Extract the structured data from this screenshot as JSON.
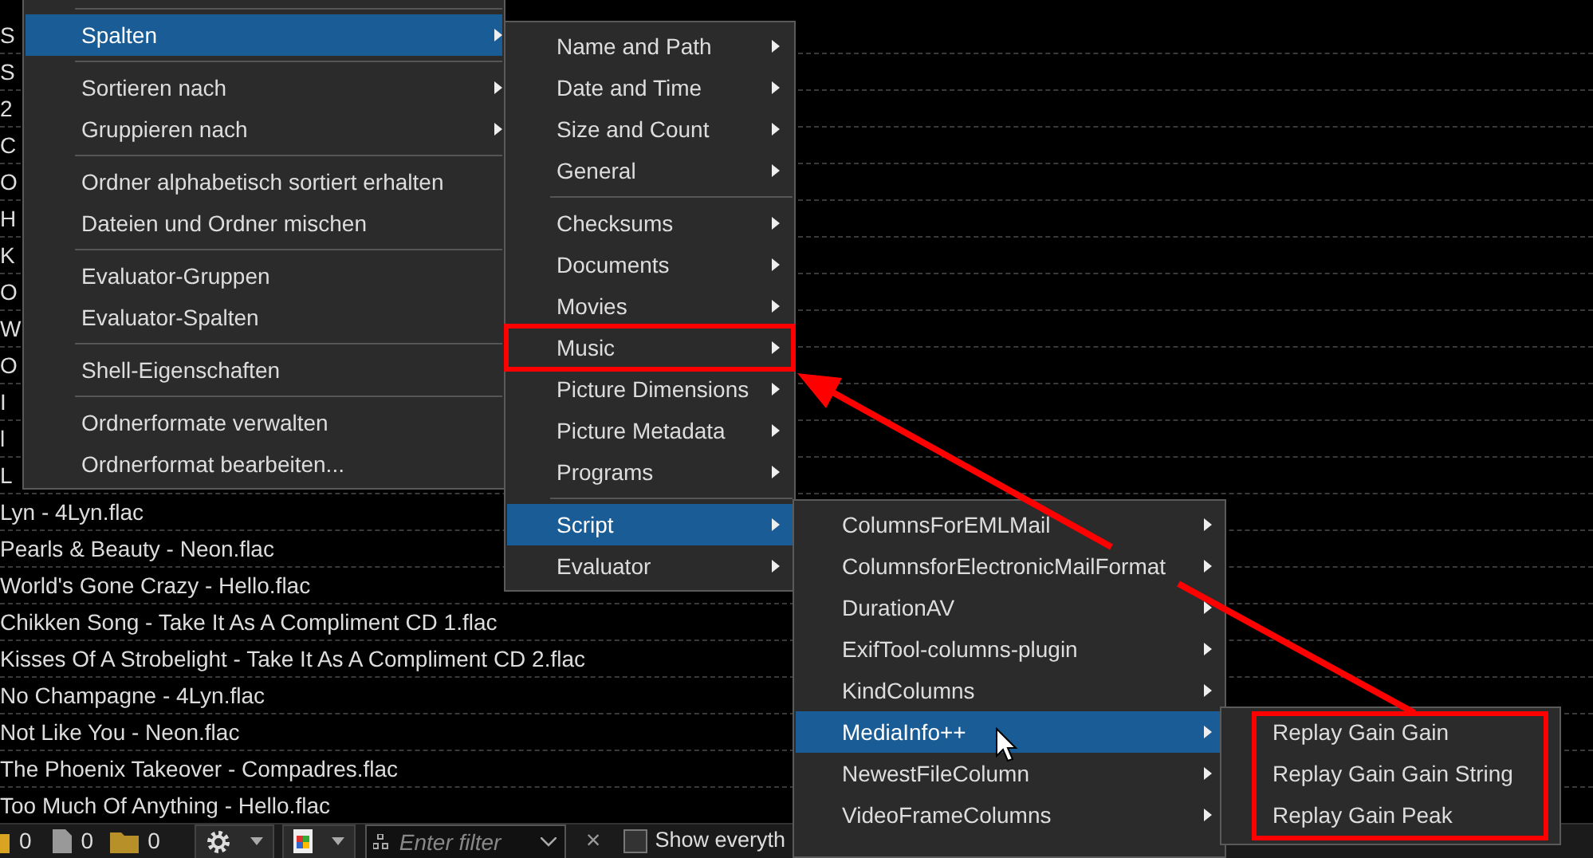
{
  "file_list": {
    "rows": [
      "S",
      "S",
      "2",
      "C",
      "O",
      "H",
      "K",
      "O",
      "W",
      "O",
      "I",
      "l",
      "L",
      "Lyn - 4Lyn.flac",
      "Pearls & Beauty - Neon.flac",
      "World's Gone Crazy - Hello.flac",
      "Chikken Song - Take It As A Compliment CD 1.flac",
      "Kisses Of A Strobelight - Take It As A Compliment CD 2.flac",
      "No Champagne - 4Lyn.flac",
      "Not Like You - Neon.flac",
      "The Phoenix Takeover - Compadres.flac",
      "Too Much Of Anything - Hello.flac"
    ]
  },
  "menus": [
    {
      "items": [
        {
          "kind": "separator"
        },
        {
          "kind": "item",
          "label": "Spalten",
          "selected": true,
          "submenu": true,
          "annotated": false
        },
        {
          "kind": "separator"
        },
        {
          "kind": "item",
          "label": "Sortieren nach",
          "selected": false,
          "submenu": true,
          "annotated": false
        },
        {
          "kind": "item",
          "label": "Gruppieren nach",
          "selected": false,
          "submenu": true,
          "annotated": false
        },
        {
          "kind": "separator"
        },
        {
          "kind": "item",
          "label": "Ordner alphabetisch sortiert erhalten",
          "selected": false,
          "submenu": false,
          "annotated": false
        },
        {
          "kind": "item",
          "label": "Dateien und Ordner mischen",
          "selected": false,
          "submenu": false,
          "annotated": false
        },
        {
          "kind": "separator"
        },
        {
          "kind": "item",
          "label": "Evaluator-Gruppen",
          "selected": false,
          "submenu": false,
          "annotated": false
        },
        {
          "kind": "item",
          "label": "Evaluator-Spalten",
          "selected": false,
          "submenu": false,
          "annotated": false
        },
        {
          "kind": "separator"
        },
        {
          "kind": "item",
          "label": "Shell-Eigenschaften",
          "selected": false,
          "submenu": false,
          "annotated": false
        },
        {
          "kind": "separator"
        },
        {
          "kind": "item",
          "label": "Ordnerformate verwalten",
          "selected": false,
          "submenu": false,
          "annotated": false
        },
        {
          "kind": "item",
          "label": "Ordnerformat bearbeiten...",
          "selected": false,
          "submenu": false,
          "annotated": false
        }
      ]
    },
    {
      "items": [
        {
          "kind": "item",
          "label": "Name and Path",
          "selected": false,
          "submenu": true,
          "annotated": false
        },
        {
          "kind": "item",
          "label": "Date and Time",
          "selected": false,
          "submenu": true,
          "annotated": false
        },
        {
          "kind": "item",
          "label": "Size and Count",
          "selected": false,
          "submenu": true,
          "annotated": false
        },
        {
          "kind": "item",
          "label": "General",
          "selected": false,
          "submenu": true,
          "annotated": false
        },
        {
          "kind": "separator"
        },
        {
          "kind": "item",
          "label": "Checksums",
          "selected": false,
          "submenu": true,
          "annotated": false
        },
        {
          "kind": "item",
          "label": "Documents",
          "selected": false,
          "submenu": true,
          "annotated": false
        },
        {
          "kind": "item",
          "label": "Movies",
          "selected": false,
          "submenu": true,
          "annotated": false
        },
        {
          "kind": "item",
          "label": "Music",
          "selected": false,
          "submenu": true,
          "annotated": true
        },
        {
          "kind": "item",
          "label": "Picture Dimensions",
          "selected": false,
          "submenu": true,
          "annotated": false
        },
        {
          "kind": "item",
          "label": "Picture Metadata",
          "selected": false,
          "submenu": true,
          "annotated": false
        },
        {
          "kind": "item",
          "label": "Programs",
          "selected": false,
          "submenu": true,
          "annotated": false
        },
        {
          "kind": "separator"
        },
        {
          "kind": "item",
          "label": "Script",
          "selected": true,
          "submenu": true,
          "annotated": false
        },
        {
          "kind": "item",
          "label": "Evaluator",
          "selected": false,
          "submenu": true,
          "annotated": false
        }
      ]
    },
    {
      "items": [
        {
          "kind": "item",
          "label": "ColumnsForEMLMail",
          "selected": false,
          "submenu": true,
          "annotated": false
        },
        {
          "kind": "item",
          "label": "ColumnsforElectronicMailFormat",
          "selected": false,
          "submenu": true,
          "annotated": false
        },
        {
          "kind": "item",
          "label": "DurationAV",
          "selected": false,
          "submenu": true,
          "annotated": false
        },
        {
          "kind": "item",
          "label": "ExifTool-columns-plugin",
          "selected": false,
          "submenu": true,
          "annotated": false
        },
        {
          "kind": "item",
          "label": "KindColumns",
          "selected": false,
          "submenu": true,
          "annotated": false
        },
        {
          "kind": "item",
          "label": "MediaInfo++",
          "selected": true,
          "submenu": true,
          "annotated": false
        },
        {
          "kind": "item",
          "label": "NewestFileColumn",
          "selected": false,
          "submenu": true,
          "annotated": false
        },
        {
          "kind": "item",
          "label": "VideoFrameColumns",
          "selected": false,
          "submenu": true,
          "annotated": false
        }
      ]
    },
    {
      "annotated": true,
      "items": [
        {
          "kind": "item",
          "label": "Replay Gain Gain",
          "selected": false,
          "submenu": false,
          "annotated": false
        },
        {
          "kind": "item",
          "label": "Replay Gain Gain String",
          "selected": false,
          "submenu": false,
          "annotated": false
        },
        {
          "kind": "item",
          "label": "Replay Gain Peak",
          "selected": false,
          "submenu": false,
          "annotated": false
        }
      ]
    }
  ],
  "status_bar": {
    "counts": [
      "0",
      "0",
      "0"
    ],
    "filter": {
      "placeholder": "Enter filter"
    },
    "clear": "×",
    "show_everything": {
      "label": "Show everyth",
      "checked": false
    }
  }
}
